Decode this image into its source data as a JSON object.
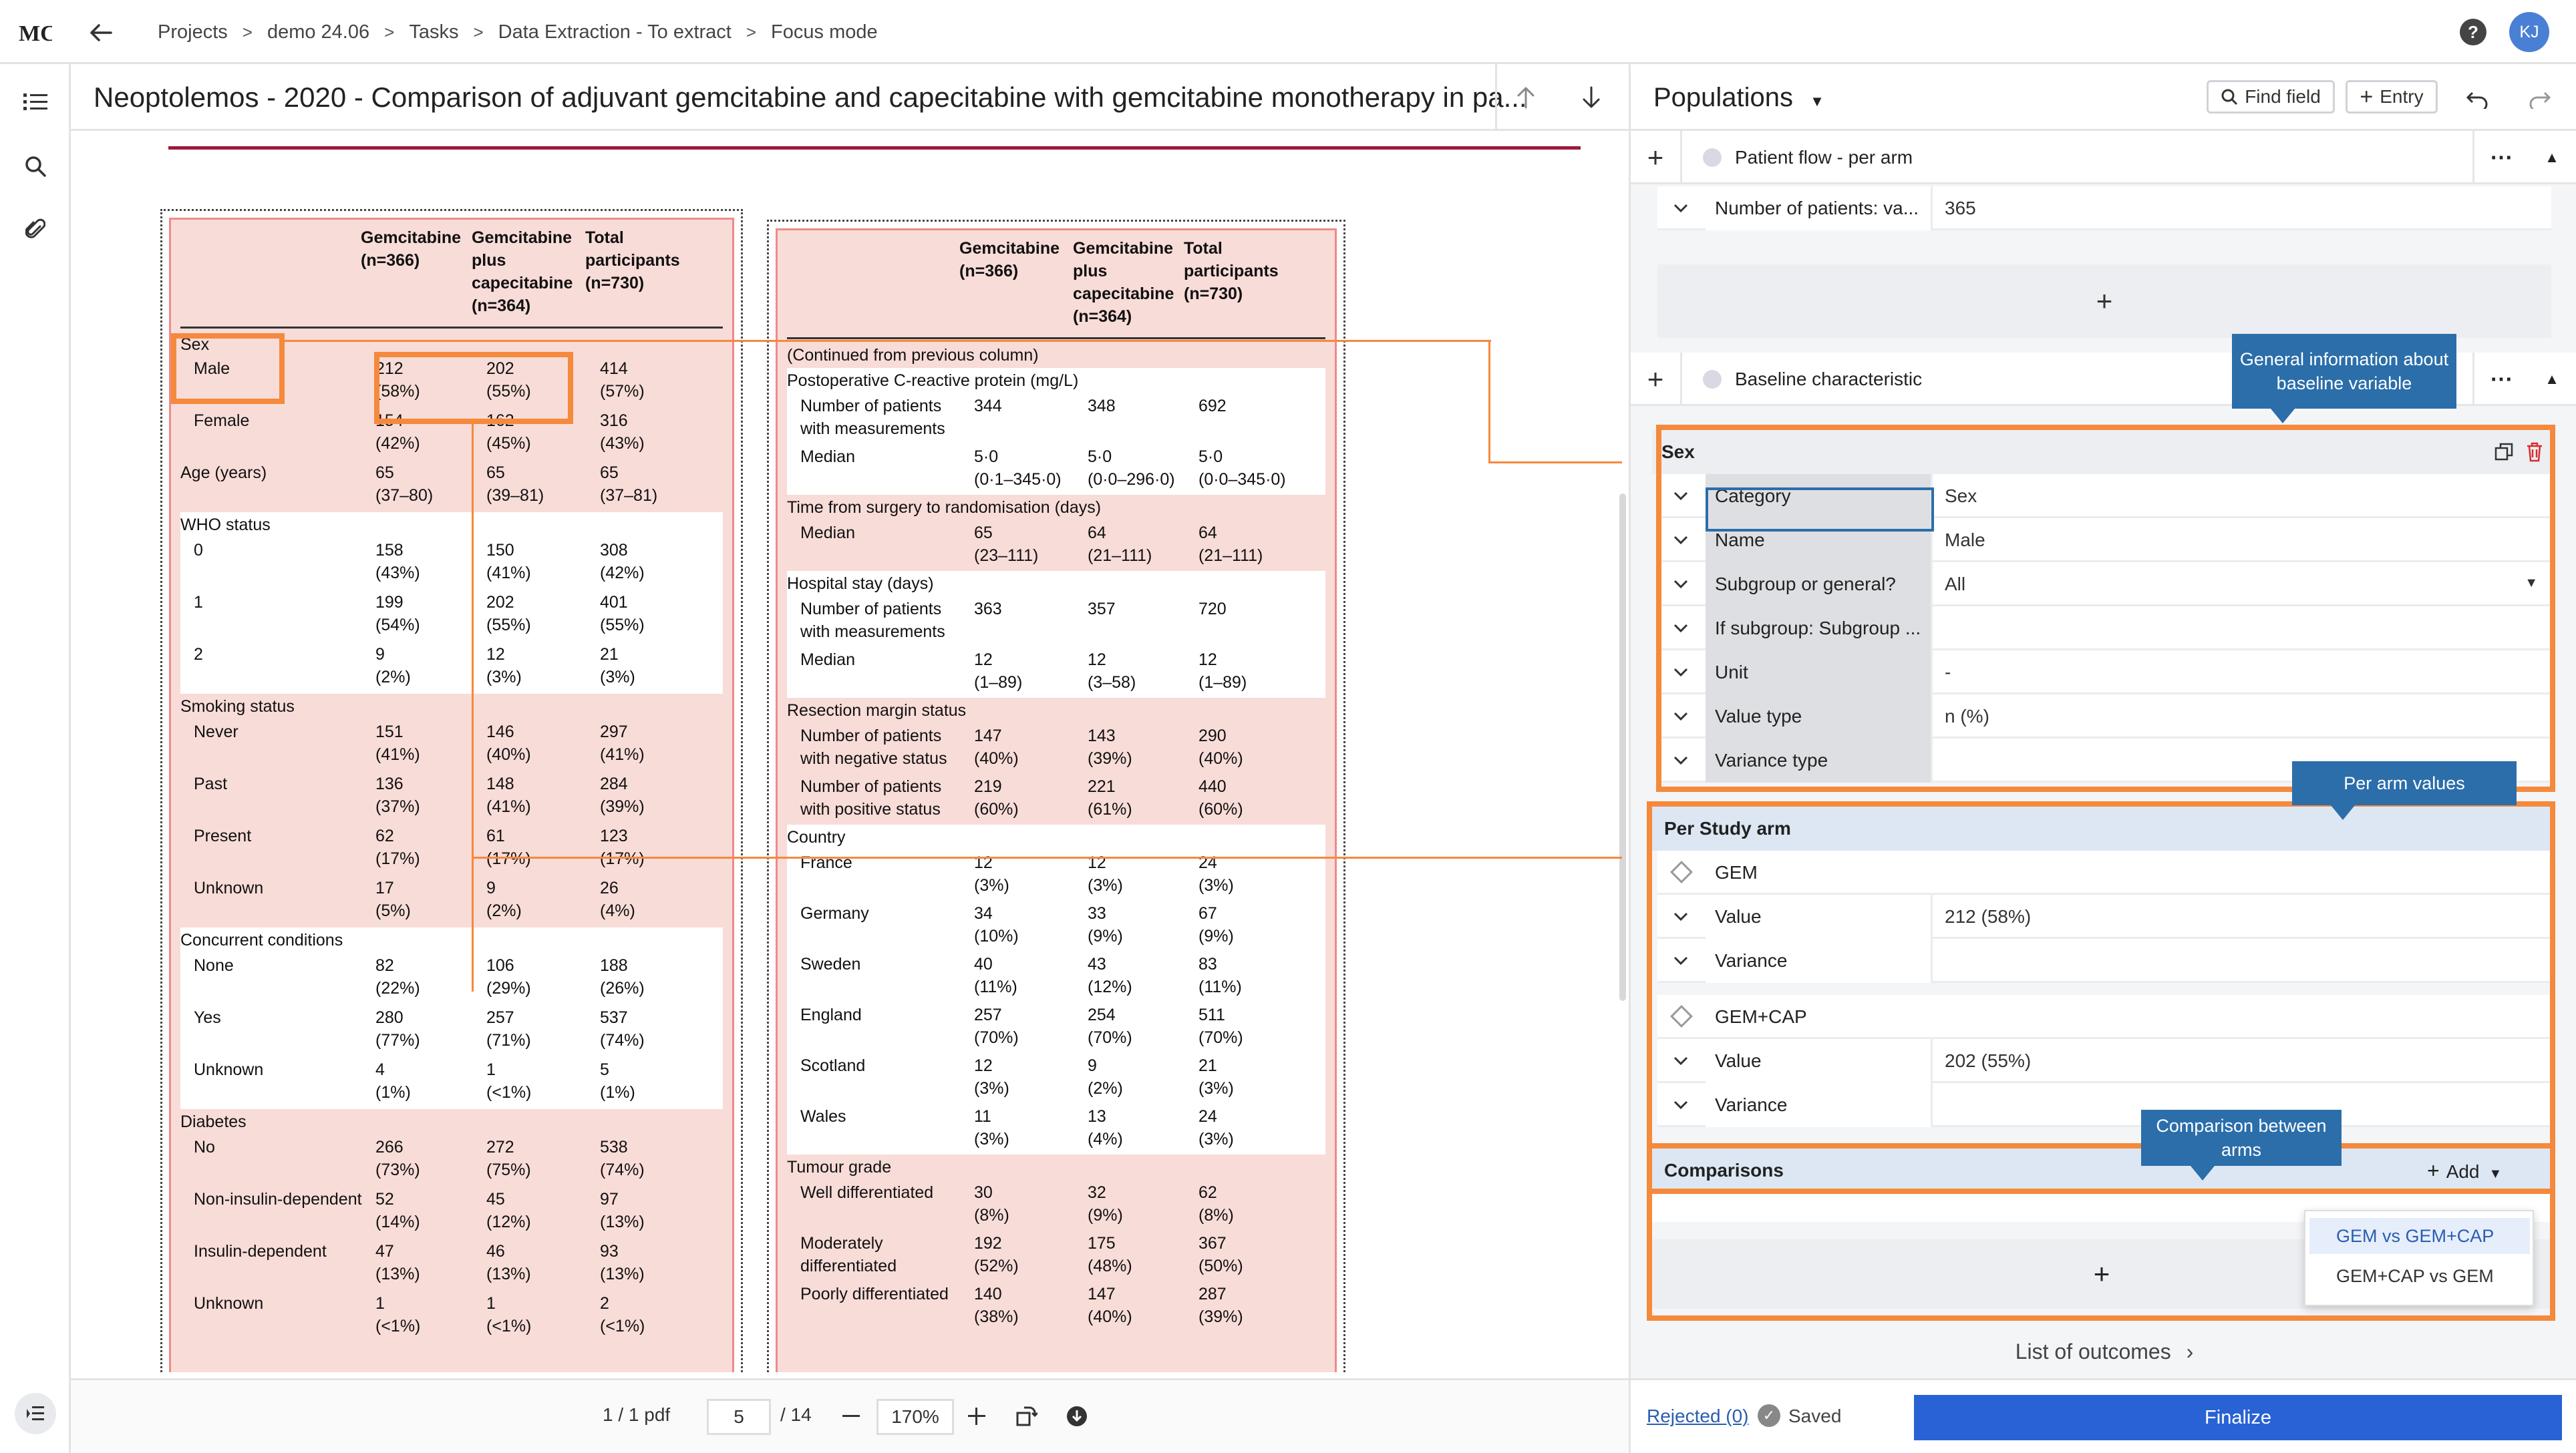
{
  "topbar": {
    "breadcrumbs": [
      "Projects",
      "demo 24.06",
      "Tasks",
      "Data Extraction - To extract",
      "Focus mode"
    ],
    "avatar_initials": "KJ"
  },
  "document": {
    "title": "Neoptolemos - 2020 - Comparison of adjuvant gemcitabine and capecitabine with gemcitabine monotherapy in pa...",
    "pdf_counter": "1 / 1 pdf",
    "page_current": "5",
    "page_total": "/ 14",
    "zoom": "170%"
  },
  "table_left": {
    "headers": [
      [
        "Gemcitabine",
        "(n=366)"
      ],
      [
        "Gemcitabine",
        "plus",
        "capecitabine",
        "(n=364)"
      ],
      [
        "Total",
        "participants",
        "(n=730)"
      ]
    ],
    "rows": [
      {
        "label": "Sex",
        "type": "section"
      },
      {
        "label": "Male",
        "values": [
          [
            "212",
            "(58%)"
          ],
          [
            "202",
            "(55%)"
          ],
          [
            "414",
            "(57%)"
          ]
        ]
      },
      {
        "label": "Female",
        "values": [
          [
            "154",
            "(42%)"
          ],
          [
            "162",
            "(45%)"
          ],
          [
            "316",
            "(43%)"
          ]
        ]
      },
      {
        "label": "Age (years)",
        "type": "section-inline",
        "values": [
          [
            "65",
            "(37–80)"
          ],
          [
            "65",
            "(39–81)"
          ],
          [
            "65",
            "(37–81)"
          ]
        ]
      },
      {
        "label": "WHO status",
        "type": "section"
      },
      {
        "label": "0",
        "values": [
          [
            "158",
            "(43%)"
          ],
          [
            "150",
            "(41%)"
          ],
          [
            "308",
            "(42%)"
          ]
        ]
      },
      {
        "label": "1",
        "values": [
          [
            "199",
            "(54%)"
          ],
          [
            "202",
            "(55%)"
          ],
          [
            "401",
            "(55%)"
          ]
        ]
      },
      {
        "label": "2",
        "values": [
          [
            "9",
            "(2%)"
          ],
          [
            "12",
            "(3%)"
          ],
          [
            "21",
            "(3%)"
          ]
        ]
      },
      {
        "label": "Smoking status",
        "type": "section"
      },
      {
        "label": "Never",
        "values": [
          [
            "151",
            "(41%)"
          ],
          [
            "146",
            "(40%)"
          ],
          [
            "297",
            "(41%)"
          ]
        ]
      },
      {
        "label": "Past",
        "values": [
          [
            "136",
            "(37%)"
          ],
          [
            "148",
            "(41%)"
          ],
          [
            "284",
            "(39%)"
          ]
        ]
      },
      {
        "label": "Present",
        "values": [
          [
            "62",
            "(17%)"
          ],
          [
            "61",
            "(17%)"
          ],
          [
            "123",
            "(17%)"
          ]
        ]
      },
      {
        "label": "Unknown",
        "values": [
          [
            "17",
            "(5%)"
          ],
          [
            "9",
            "(2%)"
          ],
          [
            "26",
            "(4%)"
          ]
        ]
      },
      {
        "label": "Concurrent conditions",
        "type": "section"
      },
      {
        "label": "None",
        "values": [
          [
            "82",
            "(22%)"
          ],
          [
            "106",
            "(29%)"
          ],
          [
            "188",
            "(26%)"
          ]
        ]
      },
      {
        "label": "Yes",
        "values": [
          [
            "280",
            "(77%)"
          ],
          [
            "257",
            "(71%)"
          ],
          [
            "537",
            "(74%)"
          ]
        ]
      },
      {
        "label": "Unknown",
        "values": [
          [
            "4",
            "(1%)"
          ],
          [
            "1",
            "(<1%)"
          ],
          [
            "5",
            "(1%)"
          ]
        ]
      },
      {
        "label": "Diabetes",
        "type": "section"
      },
      {
        "label": "No",
        "values": [
          [
            "266",
            "(73%)"
          ],
          [
            "272",
            "(75%)"
          ],
          [
            "538",
            "(74%)"
          ]
        ]
      },
      {
        "label": "Non-insulin-dependent",
        "values": [
          [
            "52",
            "(14%)"
          ],
          [
            "45",
            "(12%)"
          ],
          [
            "97",
            "(13%)"
          ]
        ]
      },
      {
        "label": "Insulin-dependent",
        "values": [
          [
            "47",
            "(13%)"
          ],
          [
            "46",
            "(13%)"
          ],
          [
            "93",
            "(13%)"
          ]
        ]
      },
      {
        "label": "Unknown",
        "values": [
          [
            "1",
            "(<1%)"
          ],
          [
            "1",
            "(<1%)"
          ],
          [
            "2",
            "(<1%)"
          ]
        ]
      }
    ]
  },
  "table_right": {
    "headers": [
      [
        "Gemcitabine",
        "(n=366)"
      ],
      [
        "Gemcitabine",
        "plus",
        "capecitabine",
        "(n=364)"
      ],
      [
        "Total",
        "participants",
        "(n=730)"
      ]
    ],
    "rows": [
      {
        "label": "(Continued from previous column)",
        "type": "section"
      },
      {
        "label": "Postoperative C-reactive protein (mg/L)",
        "type": "section"
      },
      {
        "label": "Number of patients with measurements",
        "label2": [
          "Number of patients",
          "with measurements"
        ],
        "values": [
          [
            "344"
          ],
          [
            "348"
          ],
          [
            "692"
          ]
        ]
      },
      {
        "label": "Median",
        "values": [
          [
            "5·0",
            "(0·1–345·0)"
          ],
          [
            "5·0",
            "(0·0–296·0)"
          ],
          [
            "5·0",
            "(0·0–345·0)"
          ]
        ]
      },
      {
        "label": "Time from surgery to randomisation (days)",
        "type": "section"
      },
      {
        "label": "Median",
        "values": [
          [
            "65",
            "(23–111)"
          ],
          [
            "64",
            "(21–111)"
          ],
          [
            "64",
            "(21–111)"
          ]
        ]
      },
      {
        "label": "Hospital stay (days)",
        "type": "section"
      },
      {
        "label": "Number of patients with measurements",
        "label2": [
          "Number of patients",
          "with measurements"
        ],
        "values": [
          [
            "363"
          ],
          [
            "357"
          ],
          [
            "720"
          ]
        ]
      },
      {
        "label": "Median",
        "values": [
          [
            "12",
            "(1–89)"
          ],
          [
            "12",
            "(3–58)"
          ],
          [
            "12",
            "(1–89)"
          ]
        ]
      },
      {
        "label": "Resection margin status",
        "type": "section"
      },
      {
        "label": "Number of patients with negative status",
        "label2": [
          "Number of patients",
          "with negative status"
        ],
        "values": [
          [
            "147",
            "(40%)"
          ],
          [
            "143",
            "(39%)"
          ],
          [
            "290",
            "(40%)"
          ]
        ]
      },
      {
        "label": "Number of patients with positive status",
        "label2": [
          "Number of patients",
          "with positive status"
        ],
        "values": [
          [
            "219",
            "(60%)"
          ],
          [
            "221",
            "(61%)"
          ],
          [
            "440",
            "(60%)"
          ]
        ]
      },
      {
        "label": "Country",
        "type": "section"
      },
      {
        "label": "France",
        "values": [
          [
            "12",
            "(3%)"
          ],
          [
            "12",
            "(3%)"
          ],
          [
            "24",
            "(3%)"
          ]
        ]
      },
      {
        "label": "Germany",
        "values": [
          [
            "34",
            "(10%)"
          ],
          [
            "33",
            "(9%)"
          ],
          [
            "67",
            "(9%)"
          ]
        ]
      },
      {
        "label": "Sweden",
        "values": [
          [
            "40",
            "(11%)"
          ],
          [
            "43",
            "(12%)"
          ],
          [
            "83",
            "(11%)"
          ]
        ]
      },
      {
        "label": "England",
        "values": [
          [
            "257",
            "(70%)"
          ],
          [
            "254",
            "(70%)"
          ],
          [
            "511",
            "(70%)"
          ]
        ]
      },
      {
        "label": "Scotland",
        "values": [
          [
            "12",
            "(3%)"
          ],
          [
            "9",
            "(2%)"
          ],
          [
            "21",
            "(3%)"
          ]
        ]
      },
      {
        "label": "Wales",
        "values": [
          [
            "11",
            "(3%)"
          ],
          [
            "13",
            "(4%)"
          ],
          [
            "24",
            "(3%)"
          ]
        ]
      },
      {
        "label": "Tumour grade",
        "type": "section"
      },
      {
        "label": "Well differentiated",
        "values": [
          [
            "30",
            "(8%)"
          ],
          [
            "32",
            "(9%)"
          ],
          [
            "62",
            "(8%)"
          ]
        ]
      },
      {
        "label": "Moderately differentiated",
        "label2": [
          "Moderately",
          "differentiated"
        ],
        "values": [
          [
            "192",
            "(52%)"
          ],
          [
            "175",
            "(48%)"
          ],
          [
            "367",
            "(50%)"
          ]
        ]
      },
      {
        "label": "Poorly differentiated",
        "values": [
          [
            "140",
            "(38%)"
          ],
          [
            "147",
            "(40%)"
          ],
          [
            "287",
            "(39%)"
          ]
        ]
      }
    ]
  },
  "panel": {
    "title": "Populations",
    "find_field": "Find field",
    "entry": "Entry",
    "patient_flow": "Patient flow - per arm",
    "num_patients_label": "Number of patients: va...",
    "num_patients_value": "365",
    "baseline": "Baseline characteristic",
    "sex_header": "Sex",
    "fields": [
      {
        "label": "Category",
        "value": "Sex"
      },
      {
        "label": "Name",
        "value": "Male"
      },
      {
        "label": "Subgroup or general?",
        "value": "All"
      },
      {
        "label": "If subgroup: Subgroup ...",
        "value": ""
      },
      {
        "label": "Unit",
        "value": "-"
      },
      {
        "label": "Value type",
        "value": "n (%)"
      },
      {
        "label": "Variance type",
        "value": ""
      }
    ],
    "per_study_arm": "Per Study arm",
    "arms": [
      {
        "name": "GEM",
        "value_label": "Value",
        "value": "212 (58%)",
        "variance_label": "Variance",
        "variance": ""
      },
      {
        "name": "GEM+CAP",
        "value_label": "Value",
        "value": "202 (55%)",
        "variance_label": "Variance",
        "variance": ""
      }
    ],
    "comparisons": "Comparisons",
    "add": "Add",
    "dropdown_options": [
      "GEM vs GEM+CAP",
      "GEM+CAP vs GEM"
    ],
    "list_of_outcomes": "List of outcomes",
    "rejected": "Rejected (0)",
    "saved": "Saved",
    "finalize": "Finalize"
  },
  "tooltips": {
    "general": "General information about baseline variable",
    "per_arm": "Per arm values",
    "comparison": "Comparison between arms"
  },
  "colors": {
    "accent_orange": "#f5893c",
    "tooltip_blue": "#2b6eaa",
    "finalize_blue": "#2962d4",
    "table_pink": "#f8dcd8",
    "doc_red_line": "#9a1b3a"
  }
}
